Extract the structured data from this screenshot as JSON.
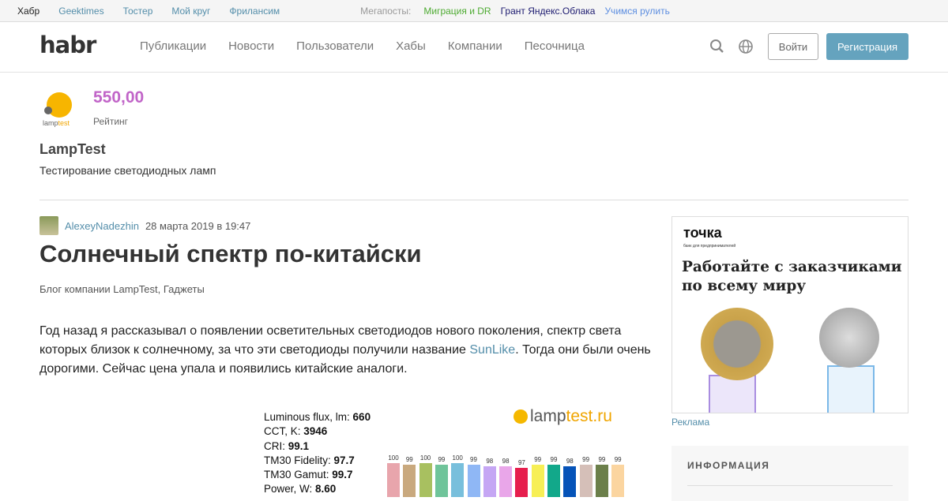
{
  "topbar": {
    "links": [
      "Хабр",
      "Geektimes",
      "Тостер",
      "Мой круг",
      "Фрилансим"
    ],
    "megaposts_label": "Мегапосты:",
    "megaposts": [
      {
        "label": "Миграция и DR",
        "color": "#4eab32"
      },
      {
        "label": "Грант Яндекс.Облака",
        "color": "#1d1b70"
      },
      {
        "label": "Учимся рулить",
        "color": "#5d8ee0"
      }
    ]
  },
  "header": {
    "logo": "habr",
    "nav": [
      "Публикации",
      "Новости",
      "Пользователи",
      "Хабы",
      "Компании",
      "Песочница"
    ],
    "login": "Войти",
    "register": "Регистрация"
  },
  "company": {
    "logo_text": "lamptest",
    "rating": "550,00",
    "rating_label": "Рейтинг",
    "name": "LampTest",
    "description": "Тестирование светодиодных ламп"
  },
  "post": {
    "author": "AlexeyNadezhin",
    "date": "28 марта 2019 в 19:47",
    "title": "Солнечный спектр по-китайски",
    "hubs": "Блог компании LampTest,  Гаджеты",
    "body_before": "Год назад я рассказывал о появлении осветительных светодиодов нового поколения, спектр света которых близок к солнечному, за что эти светодиоды получили название ",
    "body_link": "SunLike",
    "body_after": ". Тогда они были очень дорогими. Сейчас цена упала и появились китайские аналоги."
  },
  "figure": {
    "brand_a": "lamp",
    "brand_b": "test.ru",
    "stats": [
      {
        "label": "Luminous flux, lm: ",
        "value": "660"
      },
      {
        "label": "CCT, K: ",
        "value": "3946"
      },
      {
        "label": "CRI: ",
        "value": "99.1"
      },
      {
        "label": "TM30 Fidelity: ",
        "value": "97.7"
      },
      {
        "label": "TM30 Gamut: ",
        "value": "99.7"
      },
      {
        "label": "Power, W:  ",
        "value": "8.60"
      }
    ],
    "bars": [
      {
        "v": 100,
        "c": "#e8a5ac"
      },
      {
        "v": 99,
        "c": "#c9a97e"
      },
      {
        "v": 100,
        "c": "#a8c060"
      },
      {
        "v": 99,
        "c": "#6fc49a"
      },
      {
        "v": 100,
        "c": "#78bfdc"
      },
      {
        "v": 99,
        "c": "#8fb7f5"
      },
      {
        "v": 98,
        "c": "#c5a6f4"
      },
      {
        "v": 98,
        "c": "#e9a6e9"
      },
      {
        "v": 97,
        "c": "#e61e4d"
      },
      {
        "v": 99,
        "c": "#f7ef55"
      },
      {
        "v": 99,
        "c": "#12a88a"
      },
      {
        "v": 98,
        "c": "#0553b8"
      },
      {
        "v": 99,
        "c": "#d5bfb8"
      },
      {
        "v": 99,
        "c": "#6b7f4a"
      },
      {
        "v": 99,
        "c": "#fbd5a0"
      }
    ]
  },
  "ad": {
    "brand": "точка",
    "tagline": "банк для предпринимателей",
    "headline": "Работайте с заказчиками по всему миру",
    "label": "Реклама"
  },
  "sidebar": {
    "info_title": "ИНФОРМАЦИЯ"
  }
}
